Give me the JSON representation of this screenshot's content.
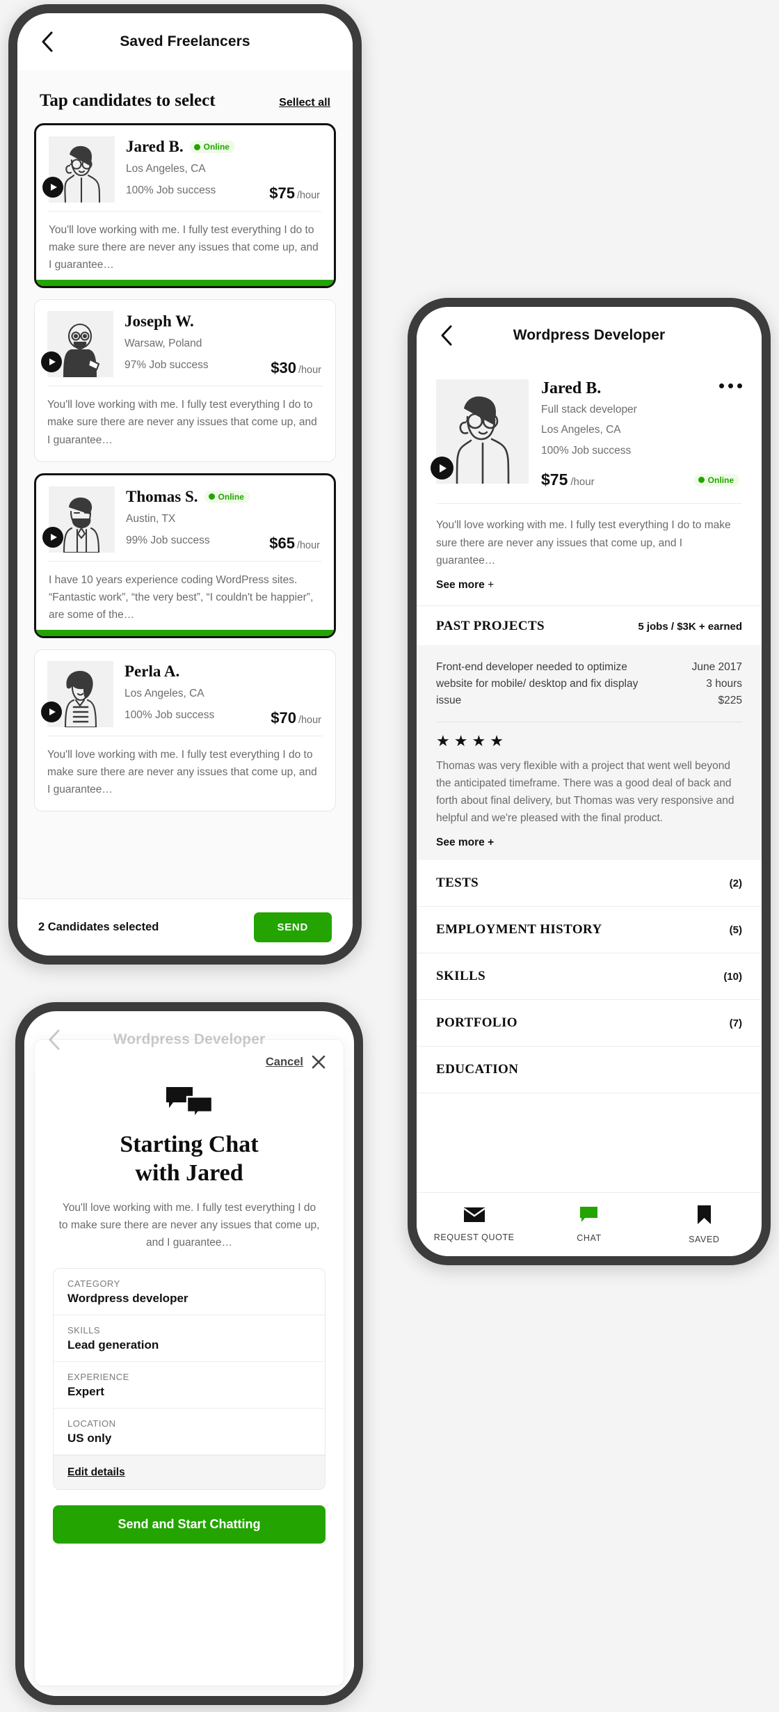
{
  "saved_screen": {
    "nav": {
      "title": "Saved Freelancers",
      "back_icon": "chevron-left-icon"
    },
    "list_header": {
      "title": "Tap candidates to select",
      "select_all": "Sellect all"
    },
    "candidates": [
      {
        "name": "Jared B.",
        "online_label": "Online",
        "online": true,
        "location": "Los Angeles, CA",
        "job_success": "100%  Job success",
        "rate_amount": "$75",
        "rate_unit": "/hour",
        "description": "You'll love working with me. I fully test everything I do to make sure there are never any issues that come up, and I guarantee…",
        "selected": true,
        "avatar": "avatar-jared"
      },
      {
        "name": "Joseph W.",
        "online_label": "",
        "online": false,
        "location": "Warsaw, Poland",
        "job_success": "97%  Job success",
        "rate_amount": "$30",
        "rate_unit": "/hour",
        "description": "You'll love working with me. I fully test everything I do to make sure there are never any issues that come up, and I guarantee…",
        "selected": false,
        "avatar": "avatar-joseph"
      },
      {
        "name": "Thomas S.",
        "online_label": "Online",
        "online": true,
        "location": "Austin, TX",
        "job_success": "99%  Job success",
        "rate_amount": "$65",
        "rate_unit": "/hour",
        "description": "I have 10 years experience coding WordPress sites. “Fantastic work”, “the very best”, “I couldn't be happier”, are some of the…",
        "selected": true,
        "avatar": "avatar-thomas"
      },
      {
        "name": "Perla A.",
        "online_label": "",
        "online": false,
        "location": "Los Angeles, CA",
        "job_success": "100%  Job success",
        "rate_amount": "$70",
        "rate_unit": "/hour",
        "description": "You'll love working with me. I fully test everything I do to make sure there are never any issues that come up, and I guarantee…",
        "selected": false,
        "avatar": "avatar-perla"
      }
    ],
    "footer": {
      "selected_count": "2 Candidates selected",
      "send_label": "SEND"
    }
  },
  "profile_screen": {
    "nav": {
      "title": "Wordpress Developer",
      "back_icon": "chevron-left-icon"
    },
    "header": {
      "name": "Jared B.",
      "role": "Full stack developer",
      "location": "Los Angeles, CA",
      "job_success": "100%  Job success",
      "rate_amount": "$75",
      "rate_unit": "/hour",
      "online_label": "Online",
      "menu_icon": "more-horizontal-icon"
    },
    "bio": "You'll love working with me. I fully test everything I do to make sure there are never any issues that come up, and I guarantee…",
    "bio_see_more": "See more",
    "past_projects": {
      "title": "PAST PROJECTS",
      "summary": "5 jobs / $3K + earned",
      "project_title": "Front-end developer needed to optimize website for mobile/ desktop and fix display issue",
      "project_date": "June 2017",
      "project_hours": "3 hours",
      "project_amount": "$225",
      "rating": 4,
      "review": "Thomas was very flexible with a project that went well beyond the anticipated timeframe. There was a good deal of back and forth about final delivery, but Thomas was very responsive and helpful and we're pleased with the final product.",
      "review_see_more": "See more"
    },
    "sections": [
      {
        "label": "TESTS",
        "count": "(2)"
      },
      {
        "label": "EMPLOYMENT HISTORY",
        "count": "(5)"
      },
      {
        "label": "SKILLS",
        "count": "(10)"
      },
      {
        "label": "PORTFOLIO",
        "count": "(7)"
      },
      {
        "label": "EDUCATION",
        "count": ""
      }
    ],
    "tabbar": [
      {
        "label": "REQUEST QUOTE",
        "icon": "mail-icon"
      },
      {
        "label": "CHAT",
        "icon": "chat-bubble-icon"
      },
      {
        "label": "SAVED",
        "icon": "bookmark-icon"
      }
    ]
  },
  "chat_modal_screen": {
    "nav": {
      "title": "Wordpress Developer",
      "back_icon": "chevron-left-icon"
    },
    "modal": {
      "cancel_label": "Cancel",
      "close_icon": "close-x-icon",
      "icon": "chat-bubbles-icon",
      "title_line1": "Starting Chat",
      "title_line2": "with Jared",
      "description": "You'll love working with me. I fully test everything I do to make sure there are never any issues that come up, and I guarantee…",
      "details": [
        {
          "label": "CATEGORY",
          "value": "Wordpress developer"
        },
        {
          "label": "SKILLS",
          "value": "Lead generation"
        },
        {
          "label": "EXPERIENCE",
          "value": "Expert"
        },
        {
          "label": "LOCATION",
          "value": "US only"
        }
      ],
      "edit_label": "Edit details",
      "submit_label": "Send and Start Chatting"
    }
  },
  "colors": {
    "accent_green": "#23a400",
    "frame": "#3c3c3c",
    "page_bg": "#f4f4f4",
    "muted_text": "#6b6b6b"
  }
}
